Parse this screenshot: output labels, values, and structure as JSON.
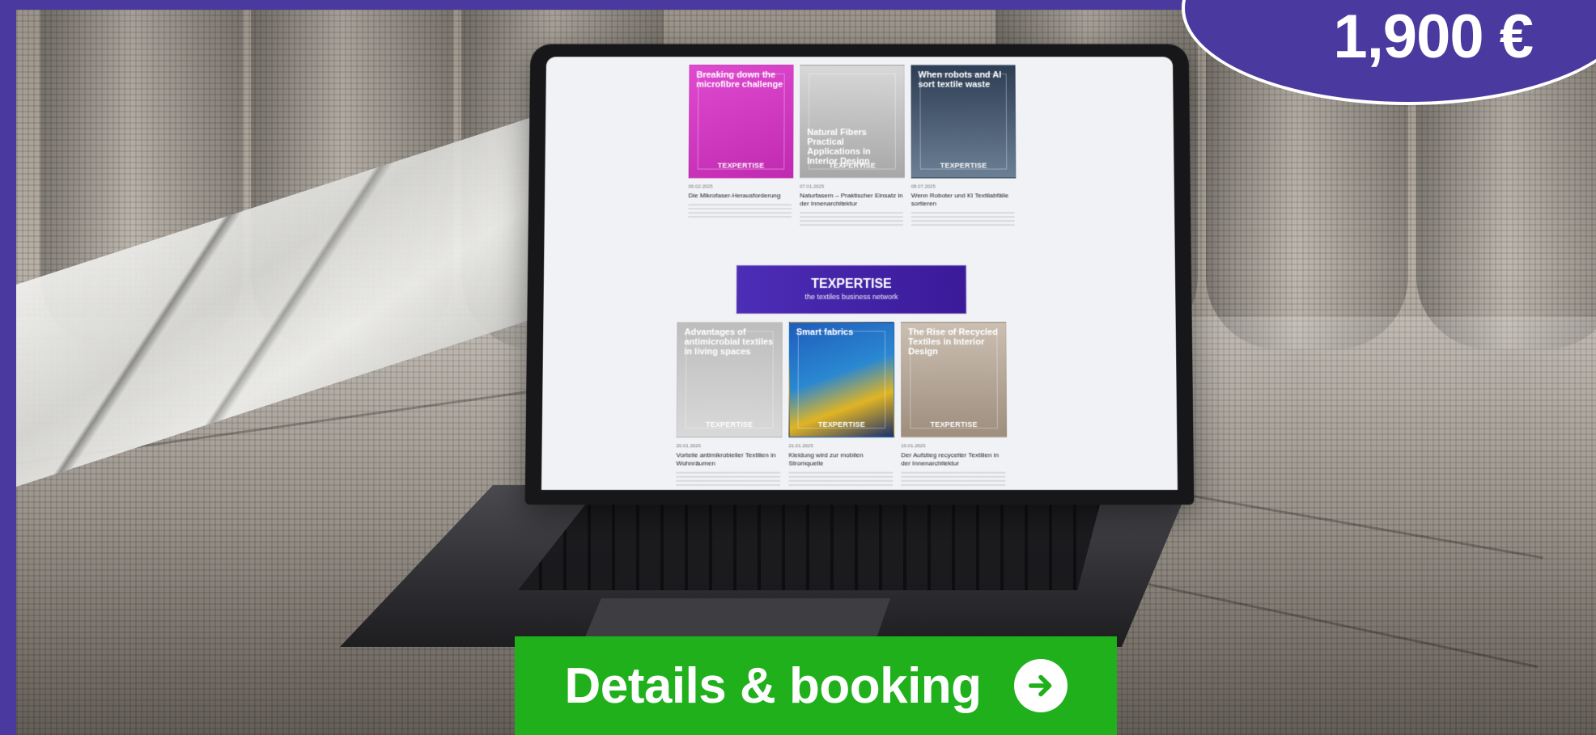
{
  "offer": {
    "price": "1,900 €"
  },
  "cta": {
    "label": "Details & booking",
    "icon": "arrow-right-circle-icon"
  },
  "screen": {
    "articles_top": [
      {
        "thumb_title": "Breaking down the microfibre challenge",
        "brand": "TEXPERTISE",
        "date": "06.02.2025",
        "headline": "Die Mikrofaser-Herausforderung"
      },
      {
        "thumb_title": "Natural Fibers Practical Applications in Interior Design",
        "brand": "TEXPERTISE",
        "date": "07.01.2025",
        "headline": "Naturfasern – Praktischer Einsatz in der Innenarchitektur"
      },
      {
        "thumb_title": "When robots and AI sort textile waste",
        "brand": "TEXPERTISE",
        "date": "08.07.2025",
        "headline": "Wenn Roboter und KI Textilabfälle sortieren"
      }
    ],
    "banner": {
      "title": "TEXPERTISE",
      "subtitle": "the textiles business network"
    },
    "articles_bottom": [
      {
        "thumb_title": "Advantages of antimicrobial textiles in living spaces",
        "brand": "TEXPERTISE",
        "date": "20.01.2025",
        "headline": "Vorteile antimikrobieller Textilien in Wohnräumen"
      },
      {
        "thumb_title": "Smart fabrics",
        "brand": "TEXPERTISE",
        "date": "21.01.2025",
        "headline": "Kleidung wird zur mobilen Stromquelle"
      },
      {
        "thumb_title": "The Rise of Recycled Textiles in Interior Design",
        "brand": "TEXPERTISE",
        "date": "16.01.2025",
        "headline": "Der Aufstieg recycelter Textilien in der Innenarchitektur"
      }
    ]
  },
  "colors": {
    "brand_purple": "#4a3aa0",
    "cta_green": "#1fb01c",
    "white": "#ffffff"
  }
}
